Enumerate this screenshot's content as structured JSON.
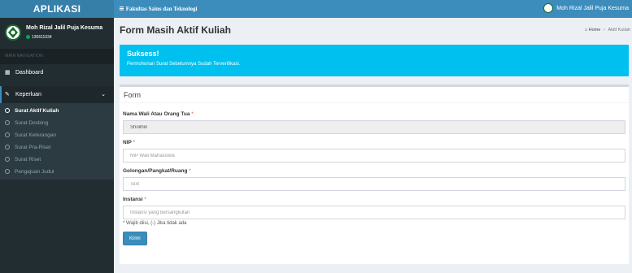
{
  "brand": "APLIKASI",
  "user": {
    "name": "Moh Rizal Jalil Puja Kesuma",
    "id": "135611034",
    "status_color": "#00a65a"
  },
  "topbar": {
    "title": "Fakultas Sains dan Teknologi",
    "user_name": "Moh Rizal Jalil Puja Kesuma"
  },
  "sidebar": {
    "nav_header": "MAIN NAVIGATION",
    "dashboard": "Dashboard",
    "keperluan": "Keperluan",
    "submenu": [
      {
        "label": "Surat Aktif Kuliah",
        "current": true
      },
      {
        "label": "Surat Dosbing",
        "current": false
      },
      {
        "label": "Surat Keterangan",
        "current": false
      },
      {
        "label": "Surat Pra-Riset",
        "current": false
      },
      {
        "label": "Surat Riset",
        "current": false
      },
      {
        "label": "Pengajuan Judul",
        "current": false
      }
    ]
  },
  "content": {
    "page_title": "Form Masih Aktif Kuliah",
    "breadcrumb": {
      "home": "Home",
      "current": "Aktif Kuliah"
    }
  },
  "alert": {
    "title": "Suksess!",
    "message": "Permohonan Surat Sebelumnya Sudah Terverifikasi.",
    "color": "#00c0ef"
  },
  "form": {
    "box_title": "Form",
    "fields": [
      {
        "label": "Nama Wali Atau Orang Tua",
        "required": "*",
        "value": "Sholihin",
        "placeholder": ""
      },
      {
        "label": "NIP",
        "required": "*",
        "value": "",
        "placeholder": "NIP Wali Mahasiswa"
      },
      {
        "label": "Golongan/Pangkat/Ruang",
        "required": "*",
        "value": "",
        "placeholder": "Text"
      },
      {
        "label": "Instansi",
        "required": "*",
        "value": "",
        "placeholder": "Instansi yang bersangkutan"
      }
    ],
    "note": "* Wajib diisi, (-) Jika tidak ada",
    "submit_label": "Kirim"
  }
}
